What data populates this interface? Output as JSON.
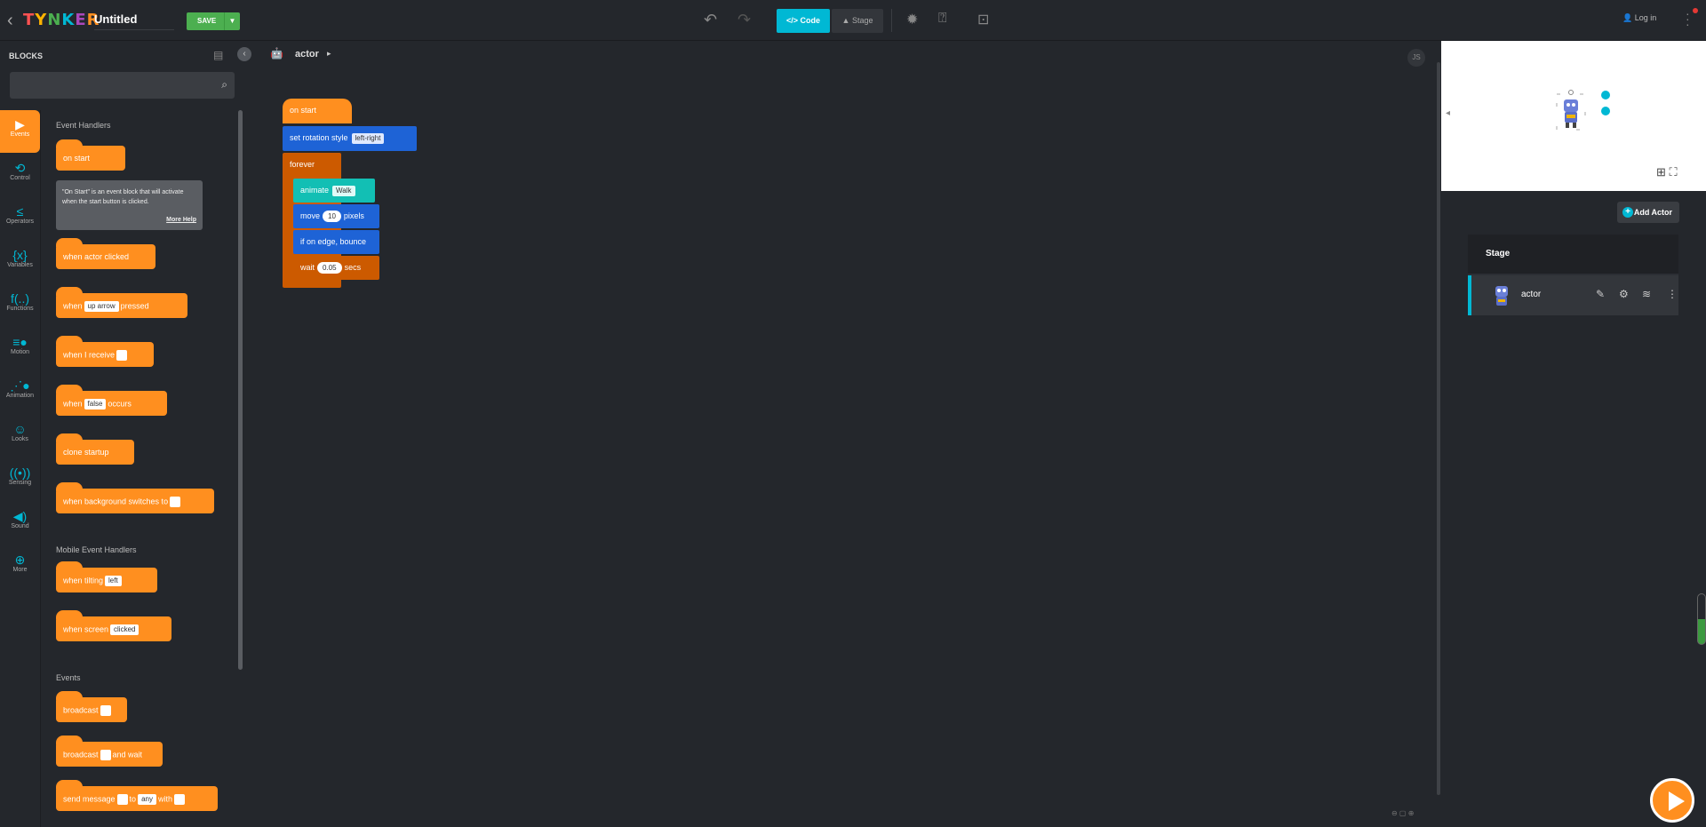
{
  "app": {
    "logo": "TYNKER",
    "title": "Untitled",
    "save_label": "SAVE"
  },
  "toolbar": {
    "code_label": "Code",
    "stage_label": "Stage",
    "login_label": "Log in"
  },
  "blocks_panel": {
    "title": "BLOCKS",
    "search_placeholder": ""
  },
  "categories": [
    {
      "label": "Events",
      "icon": "play-icon"
    },
    {
      "label": "Control",
      "icon": "loop-icon"
    },
    {
      "label": "Operators",
      "icon": "lte-icon"
    },
    {
      "label": "Variables",
      "icon": "variable-icon"
    },
    {
      "label": "Functions",
      "icon": "function-icon"
    },
    {
      "label": "Motion",
      "icon": "motion-icon"
    },
    {
      "label": "Animation",
      "icon": "animation-icon"
    },
    {
      "label": "Looks",
      "icon": "mask-icon"
    },
    {
      "label": "Sensing",
      "icon": "radio-icon"
    },
    {
      "label": "Sound",
      "icon": "speaker-icon"
    },
    {
      "label": "More",
      "icon": "plus-icon"
    }
  ],
  "palette": {
    "event_handlers_title": "Event Handlers",
    "mobile_title": "Mobile Event Handlers",
    "events_title": "Events",
    "on_start": "on start",
    "tooltip_text": "\"On Start\" is an event block that will activate when the start button is clicked.",
    "tooltip_more": "More Help",
    "actor_clicked": "when actor clicked",
    "when": "when",
    "up_arrow": "up arrow",
    "pressed": "pressed",
    "when_i_receive": "when I receive",
    "false_val": "false",
    "occurs": "occurs",
    "clone_startup": "clone startup",
    "bg_switches": "when background switches to",
    "when_tilting": "when tilting",
    "left": "left",
    "when_screen": "when screen",
    "clicked": "clicked",
    "broadcast": "broadcast",
    "and_wait": "and wait",
    "send_message": "send message",
    "to": "to",
    "any": "any",
    "with": "with"
  },
  "workspace": {
    "breadcrumb": "actor",
    "js_label": "JS",
    "on_start": "on start",
    "set_rotation": "set rotation style",
    "rotation_value": "left-right",
    "forever": "forever",
    "animate": "animate",
    "animate_value": "Walk",
    "move": "move",
    "move_value": "10",
    "pixels": "pixels",
    "edge_bounce": "if on edge, bounce",
    "wait": "wait",
    "wait_value": "0.05",
    "secs": "secs"
  },
  "stage_panel": {
    "add_actor": "Add Actor",
    "stage_label": "Stage",
    "actor_name": "actor"
  },
  "colors": {
    "events": "#ff8f1f",
    "motion": "#1e63d6",
    "control": "#cc5a00",
    "animation": "#12bfb4",
    "accent": "#00b8d4",
    "save": "#4caf50"
  }
}
